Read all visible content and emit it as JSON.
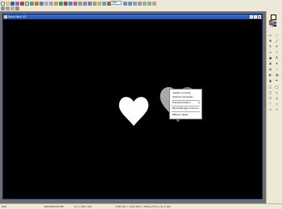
{
  "window": {
    "title": "Sans titre 12"
  },
  "toolbar": {
    "zoom": "100"
  },
  "context_menu": {
    "items": [
      {
        "label": "Valider le texte",
        "has_submenu": false
      },
      {
        "label": "Options de texte...",
        "has_submenu": false
      },
      {
        "label": "Transformation",
        "has_submenu": true
      },
      {
        "label": "Paramétrage manuel...",
        "has_submenu": false
      },
      {
        "label": "Effacer Texte",
        "has_submenu": false
      }
    ]
  },
  "status": {
    "left": "Prêt",
    "size": "800x600x24 BP",
    "zoom": "0,7 x (85 x 91)",
    "coords": "(756,40) ⇐ (142,187) (-756,0+577)  (-9+1,00)"
  },
  "palette": {
    "foreground": "#ffffff",
    "background": "#000000"
  }
}
